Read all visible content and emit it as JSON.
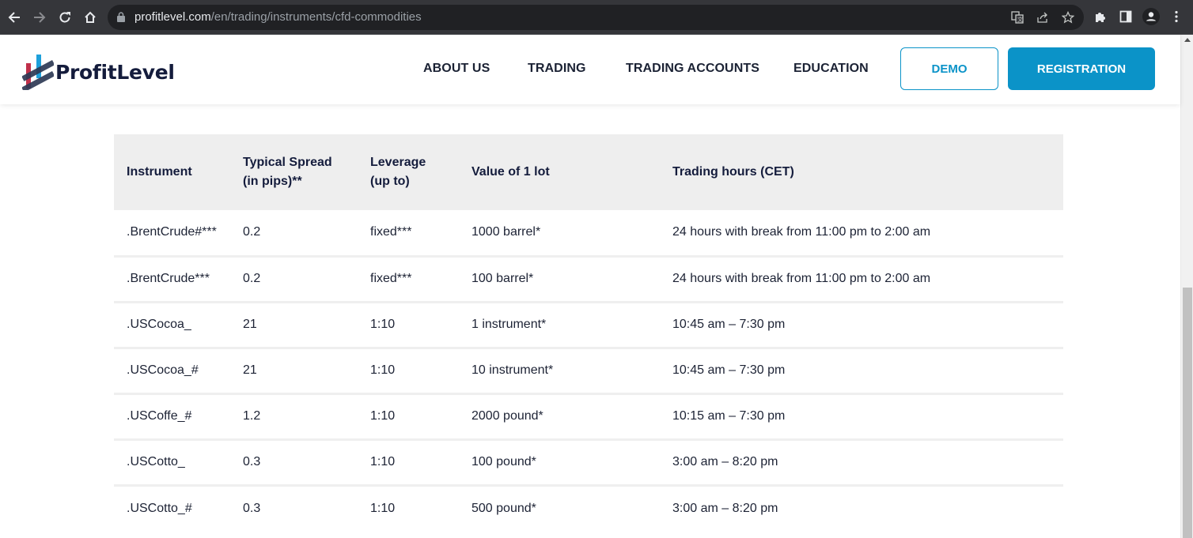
{
  "browser": {
    "url_host": "profitlevel.com",
    "url_path": "/en/trading/instruments/cfd-commodities",
    "icons": [
      "back-icon",
      "forward-icon",
      "reload-icon",
      "home-icon",
      "lock-icon",
      "translate-icon",
      "share-icon",
      "bookmark-star-icon",
      "extensions-icon",
      "side-panel-icon",
      "profile-icon",
      "menu-icon"
    ]
  },
  "header": {
    "logo_text": "ProfitLevel",
    "nav": [
      {
        "label": "ABOUT US"
      },
      {
        "label": "TRADING"
      },
      {
        "label": "TRADING ACCOUNTS"
      },
      {
        "label": "EDUCATION"
      }
    ],
    "demo_label": "DEMO",
    "registration_label": "REGISTRATION"
  },
  "colors": {
    "accent": "#0b93c8",
    "text_dark": "#141c3c",
    "header_row_bg": "#eeeeee"
  },
  "table": {
    "columns": [
      "Instrument",
      "Typical Spread (in pips)**",
      "Leverage (up to)",
      "Value of 1 lot",
      "Trading hours (CET)"
    ],
    "rows": [
      [
        ".BrentCrude#***",
        "0.2",
        "fixed***",
        "1000 barrel*",
        "24 hours with break from 11:00 pm to 2:00 am"
      ],
      [
        ".BrentCrude***",
        "0.2",
        "fixed***",
        "100 barrel*",
        "24 hours with break from 11:00 pm to 2:00 am"
      ],
      [
        ".USCocoa_",
        "21",
        "1:10",
        "1 instrument*",
        "10:45 am – 7:30 pm"
      ],
      [
        ".USCocoa_#",
        "21",
        "1:10",
        "10 instrument*",
        "10:45 am – 7:30 pm"
      ],
      [
        ".USCoffe_#",
        "1.2",
        "1:10",
        "2000 pound*",
        "10:15 am – 7:30 pm"
      ],
      [
        ".USCotto_",
        "0.3",
        "1:10",
        "100 pound*",
        "3:00 am – 8:20 pm"
      ],
      [
        ".USCotto_#",
        "0.3",
        "1:10",
        "500 pound*",
        "3:00 am – 8:20 pm"
      ]
    ]
  }
}
